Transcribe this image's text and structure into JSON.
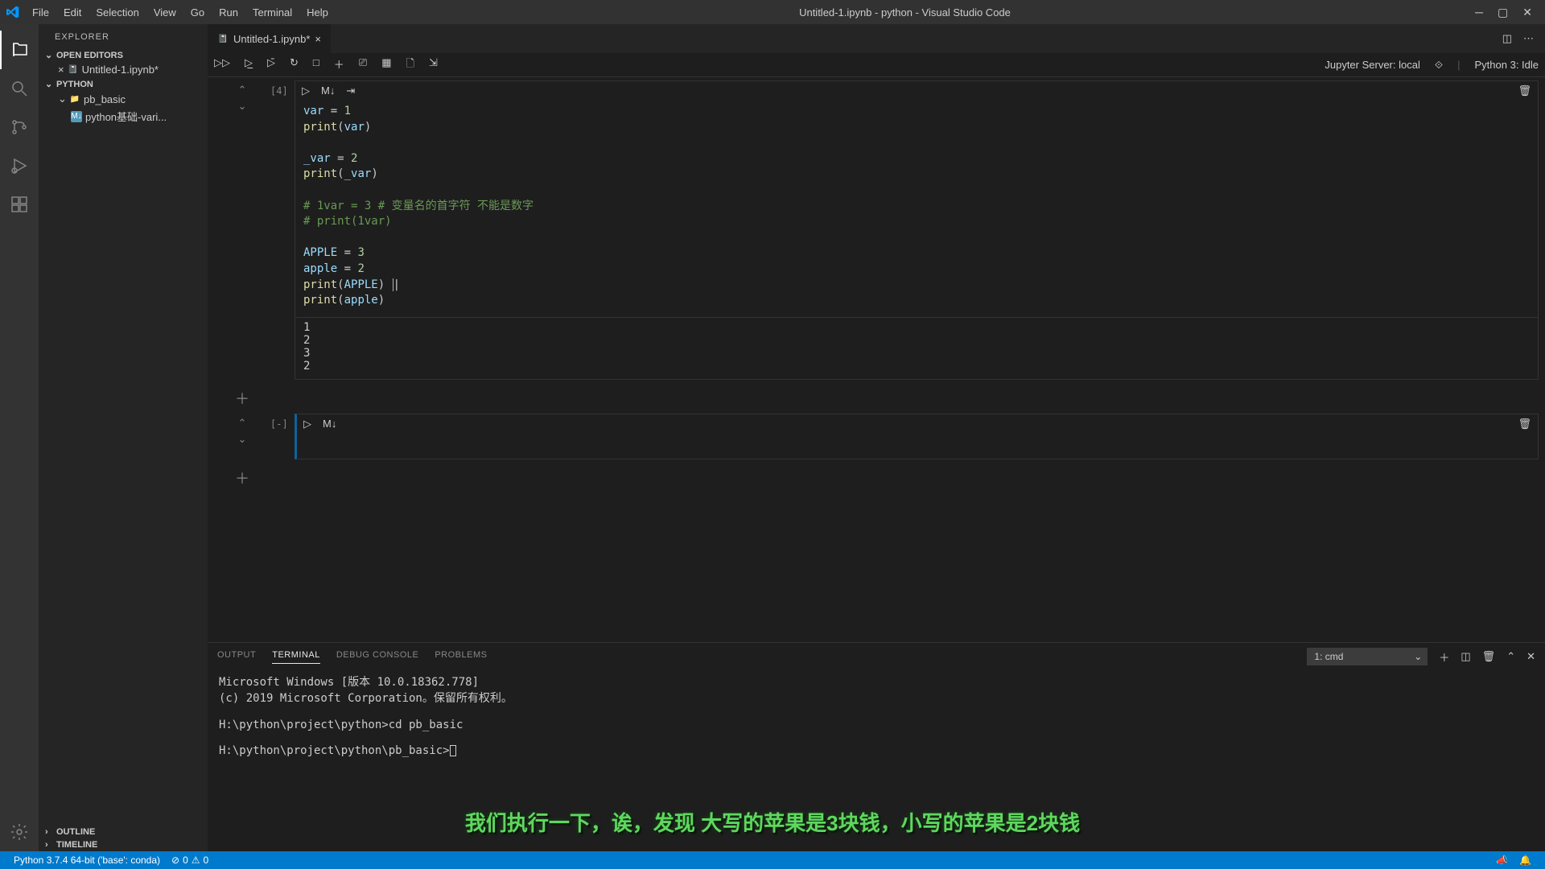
{
  "title": "Untitled-1.ipynb - python - Visual Studio Code",
  "menu": [
    "File",
    "Edit",
    "Selection",
    "View",
    "Go",
    "Run",
    "Terminal",
    "Help"
  ],
  "explorer": {
    "title": "EXPLORER",
    "sections": {
      "open_editors": "OPEN EDITORS",
      "workspace": "PYTHON",
      "outline": "OUTLINE",
      "timeline": "TIMELINE"
    },
    "open_files": [
      {
        "name": "Untitled-1.ipynb*",
        "dirty": true
      }
    ],
    "tree": {
      "folder": "pb_basic",
      "files": [
        "python基础-vari..."
      ]
    }
  },
  "tab": {
    "name": "Untitled-1.ipynb*"
  },
  "nb_status": {
    "server": "Jupyter Server: local",
    "kernel": "Python 3: Idle"
  },
  "chart_data": {
    "type": "table",
    "title": "Notebook cells",
    "cells": [
      {
        "execution_count": "[4]",
        "source": "var = 1\nprint(var)\n\n_var = 2\nprint(_var)\n\n# 1var = 3 # 变量名的首字符 不能是数字\n# print(1var)\n\nAPPLE = 3\napple = 2\nprint(APPLE)\nprint(apple)",
        "code_lines": [
          {
            "t": "assign",
            "lhs": "var",
            "rhs": "1"
          },
          {
            "t": "print",
            "arg": "var"
          },
          {
            "t": "blank"
          },
          {
            "t": "assign",
            "lhs": "_var",
            "rhs": "2"
          },
          {
            "t": "print",
            "arg": "_var"
          },
          {
            "t": "blank"
          },
          {
            "t": "comment",
            "text": "# 1var = 3 # 变量名的首字符 不能是数字"
          },
          {
            "t": "comment",
            "text": "# print(1var)"
          },
          {
            "t": "blank"
          },
          {
            "t": "assign",
            "lhs": "APPLE",
            "rhs": "3"
          },
          {
            "t": "assign",
            "lhs": "apple",
            "rhs": "2"
          },
          {
            "t": "print",
            "arg": "APPLE",
            "cursor": true
          },
          {
            "t": "print",
            "arg": "apple"
          }
        ],
        "output": "1\n2\n3\n2"
      },
      {
        "execution_count": "[-]",
        "source": "",
        "selected": true
      }
    ]
  },
  "panel": {
    "tabs": [
      "OUTPUT",
      "TERMINAL",
      "DEBUG CONSOLE",
      "PROBLEMS"
    ],
    "active_tab": "TERMINAL",
    "term_name": "1: cmd",
    "terminal_text": "Microsoft Windows [版本 10.0.18362.778]\n(c) 2019 Microsoft Corporation。保留所有权利。\n\nH:\\python\\project\\python>cd pb_basic\n\nH:\\python\\project\\python\\pb_basic>"
  },
  "status": {
    "python": "Python 3.7.4 64-bit ('base': conda)",
    "errors": "0",
    "warnings": "0"
  },
  "subtitle": "我们执行一下，诶，发现 大写的苹果是3块钱，小写的苹果是2块钱"
}
